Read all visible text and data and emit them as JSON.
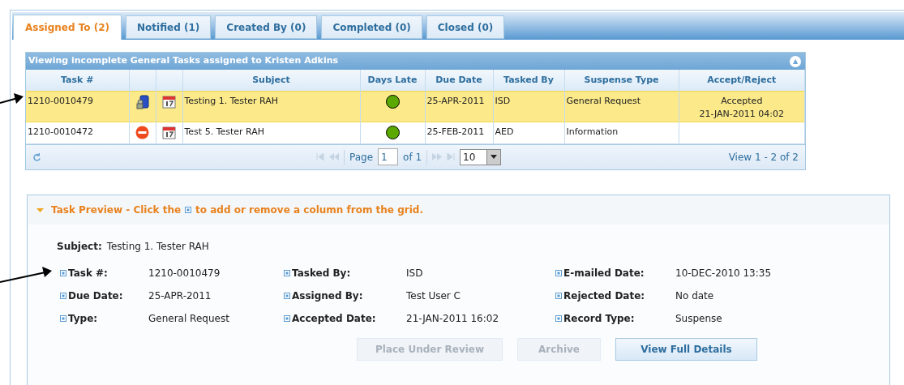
{
  "tabs": [
    {
      "label": "Assigned To (2)",
      "selected": true
    },
    {
      "label": "Notified (1)",
      "selected": false
    },
    {
      "label": "Created By (0)",
      "selected": false
    },
    {
      "label": "Completed (0)",
      "selected": false
    },
    {
      "label": "Closed (0)",
      "selected": false
    }
  ],
  "grid": {
    "title": "Viewing incomplete General Tasks assigned to Kristen Adkins",
    "collapse_icon": "▲",
    "columns": [
      "Task #",
      "Subject",
      "Days Late",
      "Due Date",
      "Tasked By",
      "Suspense Type",
      "Accept/Reject"
    ],
    "rows": [
      {
        "selected": true,
        "kind": "accepted",
        "task": "1210-0010479",
        "subject": "Testing 1. Tester RAH",
        "days_late": {
          "color": "#5aa800"
        },
        "due_date": "25-APR-2011",
        "tasked_by": "ISD",
        "suspense_type": "General Request",
        "accept_reject": [
          "Accepted",
          "21-JAN-2011 04:02"
        ]
      },
      {
        "selected": false,
        "kind": "rejected",
        "task": "1210-0010472",
        "subject": "Test 5. Tester RAH",
        "days_late": {
          "color": "#5aa800"
        },
        "due_date": "25-FEB-2011",
        "tasked_by": "AED",
        "suspense_type": "Information"
      }
    ],
    "pager": {
      "page_label": "Page",
      "page": "1",
      "of": "of 1",
      "page_size": "10",
      "view": "View 1 - 2 of 2"
    }
  },
  "preview": {
    "expanded": true,
    "heading_before": "Task Preview - Click the",
    "heading_after": "to add or remove a column from the grid.",
    "subject_label": "Subject:",
    "subject_value": "Testing 1. Tester RAH",
    "fields": [
      {
        "label": "Task #:",
        "value": "1210-0010479"
      },
      {
        "label": "Tasked By:",
        "value": "ISD"
      },
      {
        "label": "E-mailed Date:",
        "value": "10-DEC-2010 13:35"
      },
      {
        "label": "Due Date:",
        "value": "25-APR-2011"
      },
      {
        "label": "Assigned By:",
        "value": "Test User C"
      },
      {
        "label": "Rejected Date:",
        "value": "No date"
      },
      {
        "label": "Type:",
        "value": "General Request"
      },
      {
        "label": "Accepted Date:",
        "value": "21-JAN-2011 16:02"
      },
      {
        "label": "Record Type:",
        "value": "Suspense"
      }
    ],
    "buttons": [
      {
        "label": "Place Under Review",
        "disabled": true
      },
      {
        "label": "Archive",
        "disabled": true
      },
      {
        "label": "View Full Details",
        "disabled": false
      }
    ]
  }
}
